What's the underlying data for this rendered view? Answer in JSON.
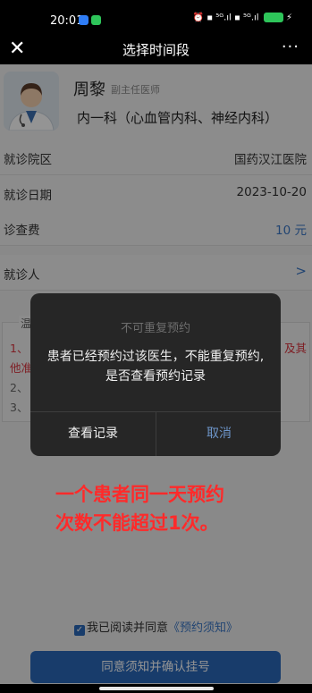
{
  "status_bar": {
    "time": "20:01",
    "right_text": "⏰ ▪ ⁵ᴳ.ıl ▪ ⁵ᴳ.ıl",
    "battery": "",
    "charging": "⚡"
  },
  "nav": {
    "title": "选择时间段",
    "close": "✕",
    "more": "···"
  },
  "doctor": {
    "name": "周黎",
    "title": "副主任医师",
    "department": "内一科（心血管内科、神经内科）"
  },
  "rows": {
    "hospital_label": "就诊院区",
    "hospital_value": "国药汉江医院",
    "date_label": "就诊日期",
    "date_value": "2023-10-20",
    "fee_label": "诊查费",
    "fee_value": "10 元",
    "patient_label": "就诊人",
    "patient_arrow": ">"
  },
  "tips": {
    "title": "温",
    "line1_left": "1、",
    "line1_right": "及其",
    "line2": "他准",
    "line3": "2、",
    "line4": "3、"
  },
  "dialog": {
    "title": "不可重复预约",
    "message": "患者已经预约过该医生，不能重复预约,是否查看预约记录",
    "left_button": "查看记录",
    "right_button": "取消"
  },
  "annotation": {
    "line1": "一个患者同一天预约",
    "line2": "次数不能超过1次。"
  },
  "footer": {
    "agree_text": "我已阅读并同意",
    "agree_link": "《预约须知》",
    "confirm_button": "同意须知并确认挂号"
  },
  "colors": {
    "accent": "#2a68b8",
    "link": "#3a76c4",
    "annotation_red": "#ff2a2a"
  }
}
